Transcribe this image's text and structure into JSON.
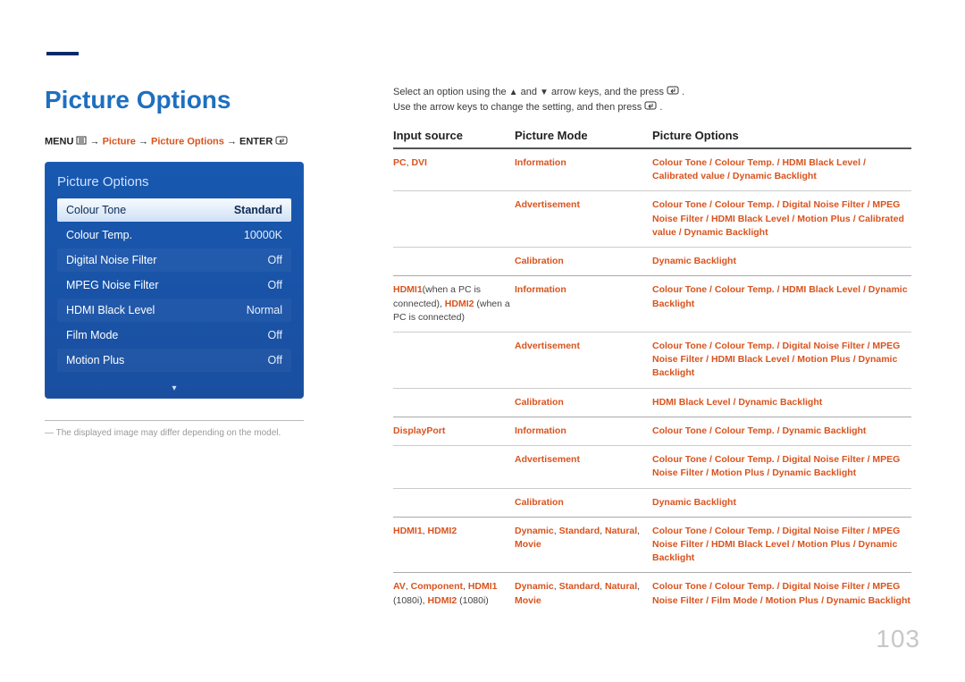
{
  "page": {
    "title": "Picture Options",
    "number": "103"
  },
  "crumb": {
    "menu": "MENU",
    "p1": "Picture",
    "p2": "Picture Options",
    "enter": "ENTER"
  },
  "panel": {
    "title": "Picture Options",
    "rows": [
      {
        "label": "Colour Tone",
        "value": "Standard",
        "selected": true
      },
      {
        "label": "Colour Temp.",
        "value": "10000K"
      },
      {
        "label": "Digital Noise Filter",
        "value": "Off"
      },
      {
        "label": "MPEG Noise Filter",
        "value": "Off"
      },
      {
        "label": "HDMI Black Level",
        "value": "Normal"
      },
      {
        "label": "Film Mode",
        "value": "Off"
      },
      {
        "label": "Motion Plus",
        "value": "Off"
      }
    ],
    "more": "▾"
  },
  "footnote": "The displayed image may differ depending on the model.",
  "instructions": {
    "line1_a": "Select an option using the ",
    "line1_b": " and ",
    "line1_c": " arrow keys, and the press ",
    "line1_d": ".",
    "line2_a": "Use the arrow keys to change the setting, and then press ",
    "line2_b": "."
  },
  "headers": {
    "c1": "Input source",
    "c2": "Picture Mode",
    "c3": "Picture Options"
  },
  "table": [
    {
      "source_html": "<span class='hot'>PC</span><span class='plain'>, </span><span class='hot'>DVI</span>",
      "rows": [
        {
          "mode_html": "<span class='hot'>Information</span>",
          "opts_html": "<span class='hot'>Colour Tone</span> <span class='sep'>/</span> <span class='hot'>Colour Temp.</span> <span class='sep'>/</span> <span class='hot'>HDMI Black Level</span> <span class='sep'>/</span> <span class='hot'>Calibrated value</span> <span class='sep'>/</span> <span class='hot'>Dynamic Backlight</span>"
        },
        {
          "mode_html": "<span class='hot'>Advertisement</span>",
          "opts_html": "<span class='hot'>Colour Tone</span> <span class='sep'>/</span> <span class='hot'>Colour Temp.</span> <span class='sep'>/</span> <span class='hot'>Digital Noise Filter</span> <span class='sep'>/</span> <span class='hot'>MPEG Noise Filter</span> <span class='sep'>/</span> <span class='hot'>HDMI Black Level</span> <span class='sep'>/</span> <span class='hot'>Motion Plus</span> <span class='sep'>/</span> <span class='hot'>Calibrated value</span> <span class='sep'>/</span> <span class='hot'>Dynamic Backlight</span>"
        },
        {
          "mode_html": "<span class='hot'>Calibration</span>",
          "opts_html": "<span class='hot'>Dynamic Backlight</span>"
        }
      ]
    },
    {
      "source_html": "<span class='hot'>HDMI1</span><span class='plain'>(when a PC is connected), </span><span class='hot'>HDMI2</span><span class='plain'> (when a PC is connected)</span>",
      "rows": [
        {
          "mode_html": "<span class='hot'>Information</span>",
          "opts_html": "<span class='hot'>Colour Tone</span> <span class='sep'>/</span> <span class='hot'>Colour Temp.</span> <span class='sep'>/</span> <span class='hot'>HDMI Black Level</span> <span class='sep'>/</span> <span class='hot'>Dynamic Backlight</span>"
        },
        {
          "mode_html": "<span class='hot'>Advertisement</span>",
          "opts_html": "<span class='hot'>Colour Tone</span> <span class='sep'>/</span> <span class='hot'>Colour Temp.</span> <span class='sep'>/</span> <span class='hot'>Digital Noise Filter</span> <span class='sep'>/</span> <span class='hot'>MPEG Noise Filter</span> <span class='sep'>/</span> <span class='hot'>HDMI Black Level</span> <span class='sep'>/</span> <span class='hot'>Motion Plus</span> <span class='sep'>/</span> <span class='hot'>Dynamic Backlight</span>"
        },
        {
          "mode_html": "<span class='hot'>Calibration</span>",
          "opts_html": "<span class='hot'>HDMI Black Level</span> <span class='sep'>/</span> <span class='hot'>Dynamic Backlight</span>"
        }
      ]
    },
    {
      "source_html": "<span class='hot'>DisplayPort</span>",
      "rows": [
        {
          "mode_html": "<span class='hot'>Information</span>",
          "opts_html": "<span class='hot'>Colour Tone</span> <span class='sep'>/</span> <span class='hot'>Colour Temp.</span> <span class='sep'>/</span> <span class='hot'>Dynamic Backlight</span>"
        },
        {
          "mode_html": "<span class='hot'>Advertisement</span>",
          "opts_html": "<span class='hot'>Colour Tone</span> <span class='sep'>/</span> <span class='hot'>Colour Temp.</span> <span class='sep'>/</span> <span class='hot'>Digital Noise Filter</span> <span class='sep'>/</span> <span class='hot'>MPEG Noise Filter</span> <span class='sep'>/</span> <span class='hot'>Motion Plus</span> <span class='sep'>/</span> <span class='hot'>Dynamic Backlight</span>"
        },
        {
          "mode_html": "<span class='hot'>Calibration</span>",
          "opts_html": "<span class='hot'>Dynamic Backlight</span>"
        }
      ]
    },
    {
      "source_html": "<span class='hot'>HDMI1</span><span class='plain'>, </span><span class='hot'>HDMI2</span>",
      "rows": [
        {
          "mode_html": "<span class='hot'>Dynamic</span><span class='plain'>, </span><span class='hot'>Standard</span><span class='plain'>, </span><span class='hot'>Natural</span><span class='plain'>, </span><span class='hot'>Movie</span>",
          "opts_html": "<span class='hot'>Colour Tone</span> <span class='sep'>/</span> <span class='hot'>Colour Temp.</span> <span class='sep'>/</span> <span class='hot'>Digital Noise Filter</span> <span class='sep'>/</span> <span class='hot'>MPEG Noise Filter</span> <span class='sep'>/</span> <span class='hot'>HDMI Black Level</span> <span class='sep'>/</span> <span class='hot'>Motion Plus</span> <span class='sep'>/</span> <span class='hot'>Dynamic Backlight</span>"
        }
      ]
    },
    {
      "source_html": "<span class='hot'>AV</span><span class='plain'>, </span><span class='hot'>Component</span><span class='plain'>, </span><span class='hot'>HDMI1</span><span class='plain'> (1080i), </span><span class='hot'>HDMI2</span><span class='plain'> (1080i)</span>",
      "rows": [
        {
          "mode_html": "<span class='hot'>Dynamic</span><span class='plain'>, </span><span class='hot'>Standard</span><span class='plain'>, </span><span class='hot'>Natural</span><span class='plain'>, </span><span class='hot'>Movie</span>",
          "opts_html": "<span class='hot'>Colour Tone</span> <span class='sep'>/</span> <span class='hot'>Colour Temp.</span> <span class='sep'>/</span> <span class='hot'>Digital Noise Filter</span> <span class='sep'>/</span> <span class='hot'>MPEG Noise Filter</span> <span class='sep'>/</span> <span class='hot'>Film Mode</span> <span class='sep'>/</span> <span class='hot'>Motion Plus</span> <span class='sep'>/</span> <span class='hot'>Dynamic Backlight</span>"
        }
      ]
    }
  ]
}
